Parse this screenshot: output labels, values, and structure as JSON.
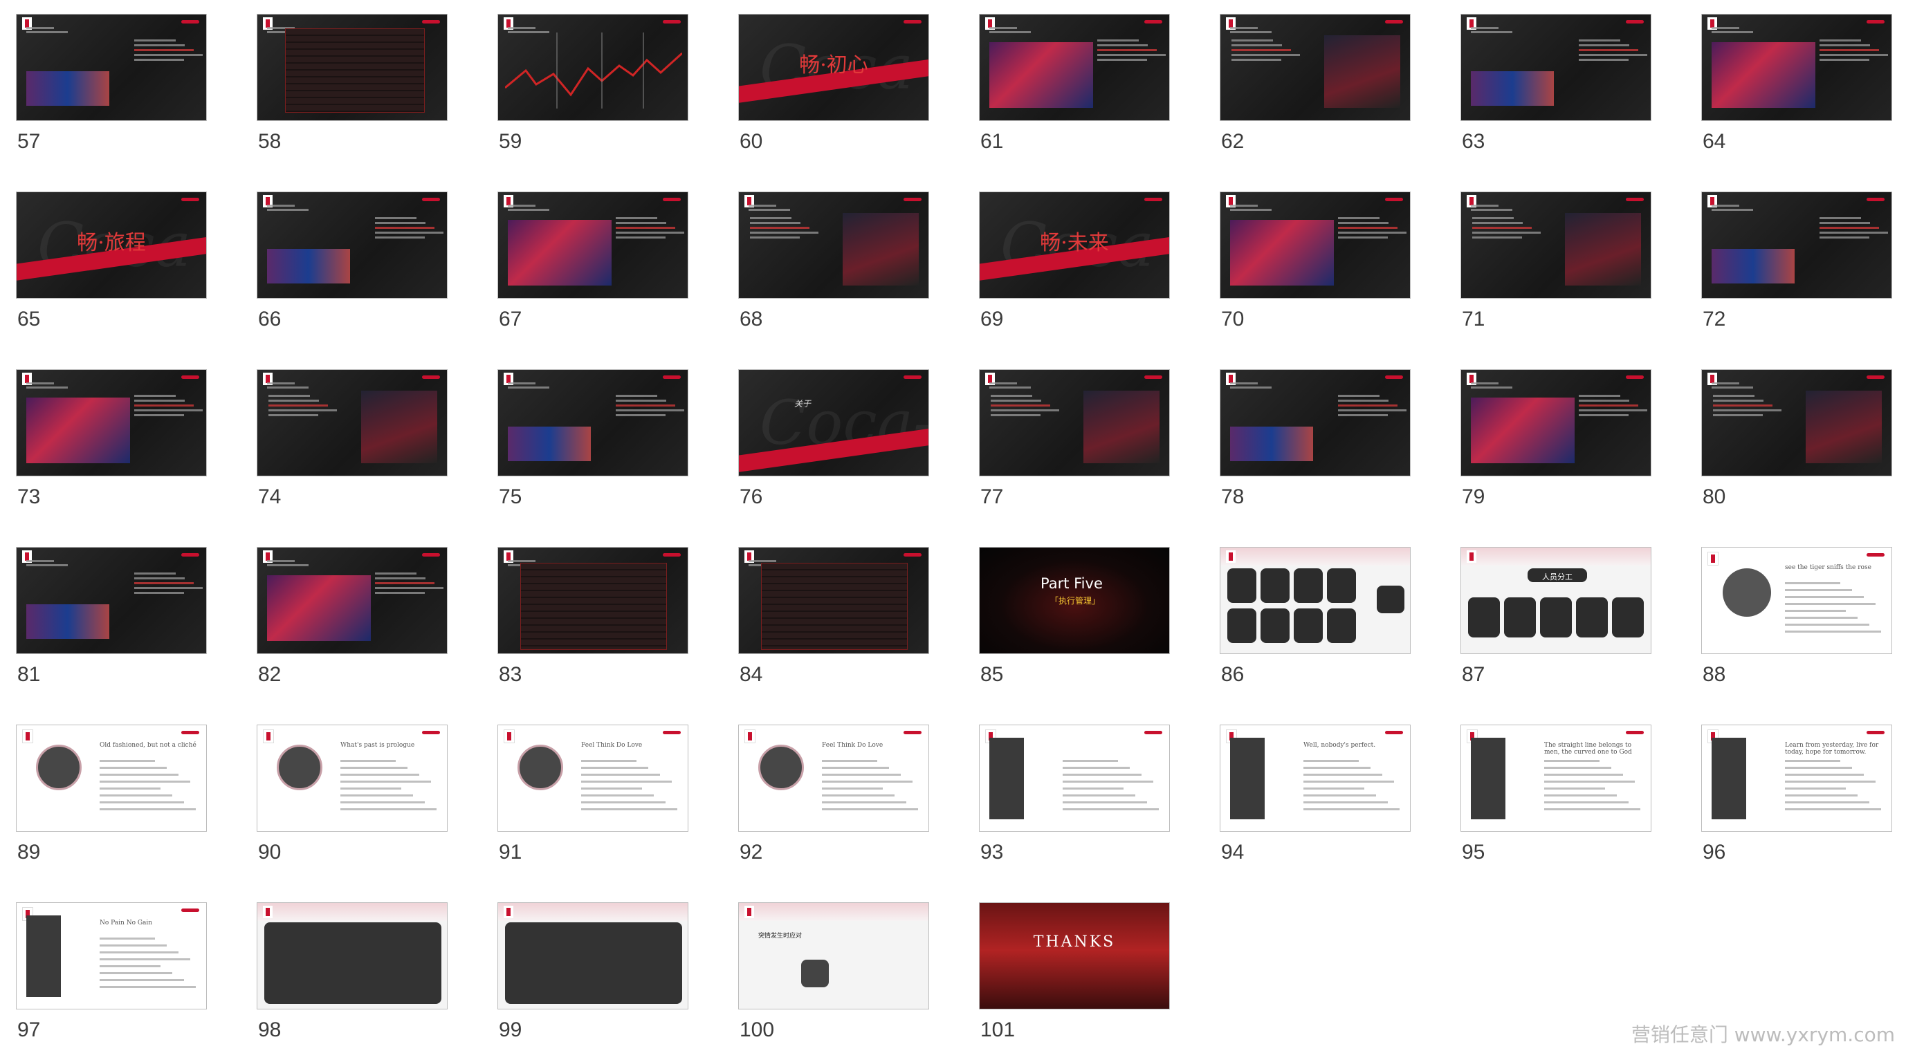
{
  "slides": [
    {
      "n": "57"
    },
    {
      "n": "58"
    },
    {
      "n": "59"
    },
    {
      "n": "60",
      "title": "畅·初心"
    },
    {
      "n": "61"
    },
    {
      "n": "62"
    },
    {
      "n": "63"
    },
    {
      "n": "64"
    },
    {
      "n": "65",
      "title": "畅·旅程"
    },
    {
      "n": "66"
    },
    {
      "n": "67"
    },
    {
      "n": "68"
    },
    {
      "n": "69",
      "title": "畅·未来"
    },
    {
      "n": "70"
    },
    {
      "n": "71"
    },
    {
      "n": "72"
    },
    {
      "n": "73"
    },
    {
      "n": "74"
    },
    {
      "n": "75"
    },
    {
      "n": "76",
      "title": "关于"
    },
    {
      "n": "77"
    },
    {
      "n": "78"
    },
    {
      "n": "79"
    },
    {
      "n": "80"
    },
    {
      "n": "81"
    },
    {
      "n": "82"
    },
    {
      "n": "83"
    },
    {
      "n": "84"
    },
    {
      "n": "85",
      "title": "Part Five",
      "subtitle": "「执行管理」"
    },
    {
      "n": "86"
    },
    {
      "n": "87",
      "title": "人员分工"
    },
    {
      "n": "88",
      "title": "see the tiger sniffs the rose"
    },
    {
      "n": "89",
      "title": "Old fashioned, but not a cliché"
    },
    {
      "n": "90",
      "title": "What's past is prologue"
    },
    {
      "n": "91",
      "title": "Feel Think Do Love"
    },
    {
      "n": "92",
      "title": "Feel Think Do Love"
    },
    {
      "n": "93"
    },
    {
      "n": "94",
      "title": "Well, nobody's perfect."
    },
    {
      "n": "95",
      "title": "The straight line belongs to men, the curved one to God"
    },
    {
      "n": "96",
      "title": "Learn from yesterday, live for today, hope for tomorrow."
    },
    {
      "n": "97",
      "title": "No Pain No Gain"
    },
    {
      "n": "98"
    },
    {
      "n": "99"
    },
    {
      "n": "100",
      "title": "突情发生时应对"
    },
    {
      "n": "101",
      "title": "THANKS"
    }
  ],
  "watermark": "营销任意门 www.yxrym.com"
}
